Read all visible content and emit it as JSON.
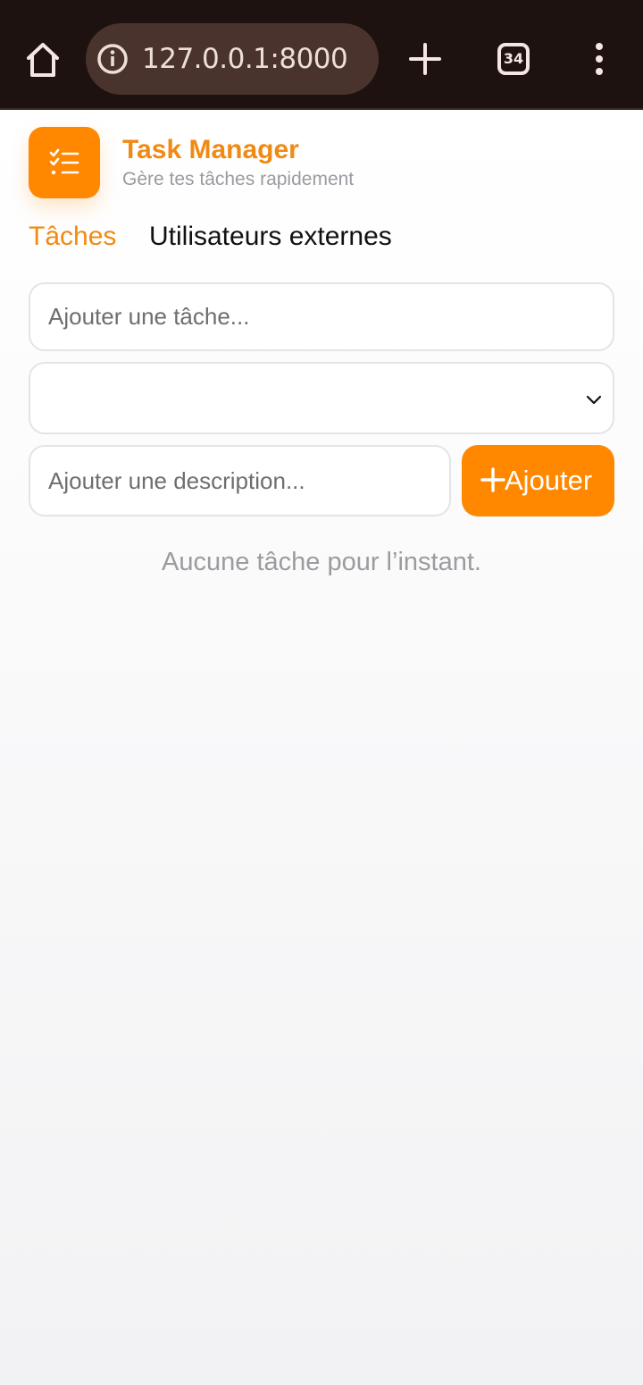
{
  "browser": {
    "url": "127.0.0.1:8000",
    "tab_count": "34",
    "icons": [
      "home-icon",
      "info-icon",
      "plus-icon",
      "tabs-icon",
      "more-vert-icon"
    ],
    "colors": {
      "toolbar": "#1d1210",
      "url_pill": "#4a332d"
    }
  },
  "app": {
    "title": "Task Manager",
    "subtitle": "Gère tes tâches rapidement",
    "logo_icon": "checklist-icon",
    "accent_color": "#ff8800"
  },
  "tabs": [
    {
      "label": "Tâches",
      "active": true
    },
    {
      "label": "Utilisateurs externes",
      "active": false
    }
  ],
  "form": {
    "task_placeholder": "Ajouter une tâche...",
    "select_value": "",
    "description_placeholder": "Ajouter une description...",
    "add_button_label": "Ajouter"
  },
  "empty_message": "Aucune tâche pour l’instant."
}
